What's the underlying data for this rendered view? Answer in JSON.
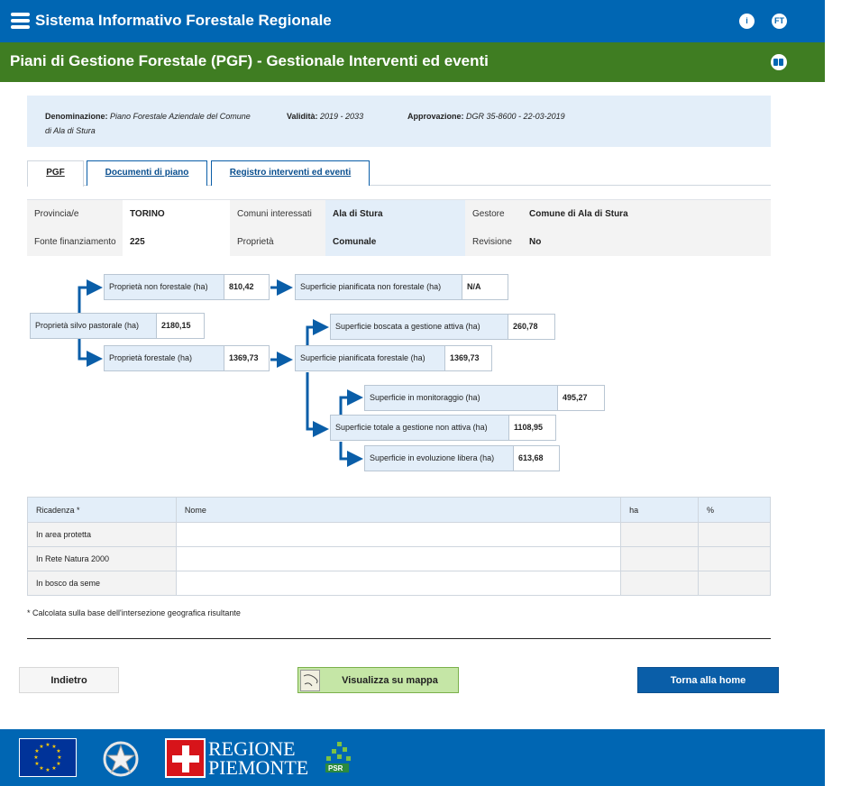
{
  "header": {
    "app_title": "Sistema Informativo Forestale Regionale",
    "info_icon_glyph": "i",
    "user_initials": "FT"
  },
  "page": {
    "title": "Piani di Gestione Forestale (PGF) - Gestionale Interventi ed eventi"
  },
  "plan_info": {
    "denominazione_label": "Denominazione:",
    "denominazione_value_line1": "Piano Forestale Aziendale del Comune",
    "denominazione_value_line2": "di Ala di Stura",
    "validita_label": "Validità:",
    "validita_value": "2019 - 2033",
    "approvazione_label": "Approvazione:",
    "approvazione_value": "DGR 35-8600 - 22-03-2019"
  },
  "tabs": [
    {
      "label": "PGF",
      "active": true
    },
    {
      "label": "Documenti di piano",
      "active": false
    },
    {
      "label": "Registro interventi ed eventi",
      "active": false
    }
  ],
  "properties": {
    "provincia_label": "Provincia/e",
    "provincia_value": "TORINO",
    "comuni_label": "Comuni interessati",
    "comuni_value": "Ala di Stura",
    "gestore_label": "Gestore",
    "gestore_value": "Comune di Ala di Stura",
    "fonte_label": "Fonte finanziamento",
    "fonte_value": "225",
    "proprieta_label": "Proprietà",
    "proprieta_value": "Comunale",
    "revisione_label": "Revisione",
    "revisione_value": "No"
  },
  "flow": {
    "silvo_pastorale": {
      "label": "Proprietà silvo pastorale (ha)",
      "value": "2180,15"
    },
    "non_forestale": {
      "label": "Proprietà non forestale (ha)",
      "value": "810,42"
    },
    "pianificata_non_forestale": {
      "label": "Superficie pianificata non forestale (ha)",
      "value": "N/A"
    },
    "forestale": {
      "label": "Proprietà forestale (ha)",
      "value": "1369,73"
    },
    "pianificata_forestale": {
      "label": "Superficie pianificata forestale (ha)",
      "value": "1369,73"
    },
    "boscata_attiva": {
      "label": "Superficie boscata a gestione attiva (ha)",
      "value": "260,78"
    },
    "monitoraggio": {
      "label": "Superficie in monitoraggio (ha)",
      "value": "495,27"
    },
    "non_attiva": {
      "label": "Superficie totale a gestione non attiva (ha)",
      "value": "1108,95"
    },
    "evoluzione_libera": {
      "label": "Superficie in evoluzione libera (ha)",
      "value": "613,68"
    }
  },
  "ricadenza": {
    "headers": [
      "Ricadenza *",
      "Nome",
      "ha",
      "%"
    ],
    "rows": [
      [
        "In area protetta",
        "",
        "",
        ""
      ],
      [
        "In Rete Natura 2000",
        "",
        "",
        ""
      ],
      [
        "In bosco da seme",
        "",
        "",
        ""
      ]
    ],
    "note": "* Calcolata sulla base dell'intersezione geografica risultante"
  },
  "buttons": {
    "back": "Indietro",
    "map": "Visualizza su mappa",
    "home": "Torna alla home"
  },
  "footer": {
    "region_line1": "REGIONE",
    "region_line2": "PIEMONTE",
    "psr_text": "PSR"
  },
  "colors": {
    "primary_blue": "#0066b3",
    "header_green": "#3f7d22",
    "panel_light_blue": "#e3eef9",
    "map_button_green": "#c5e6a6"
  }
}
